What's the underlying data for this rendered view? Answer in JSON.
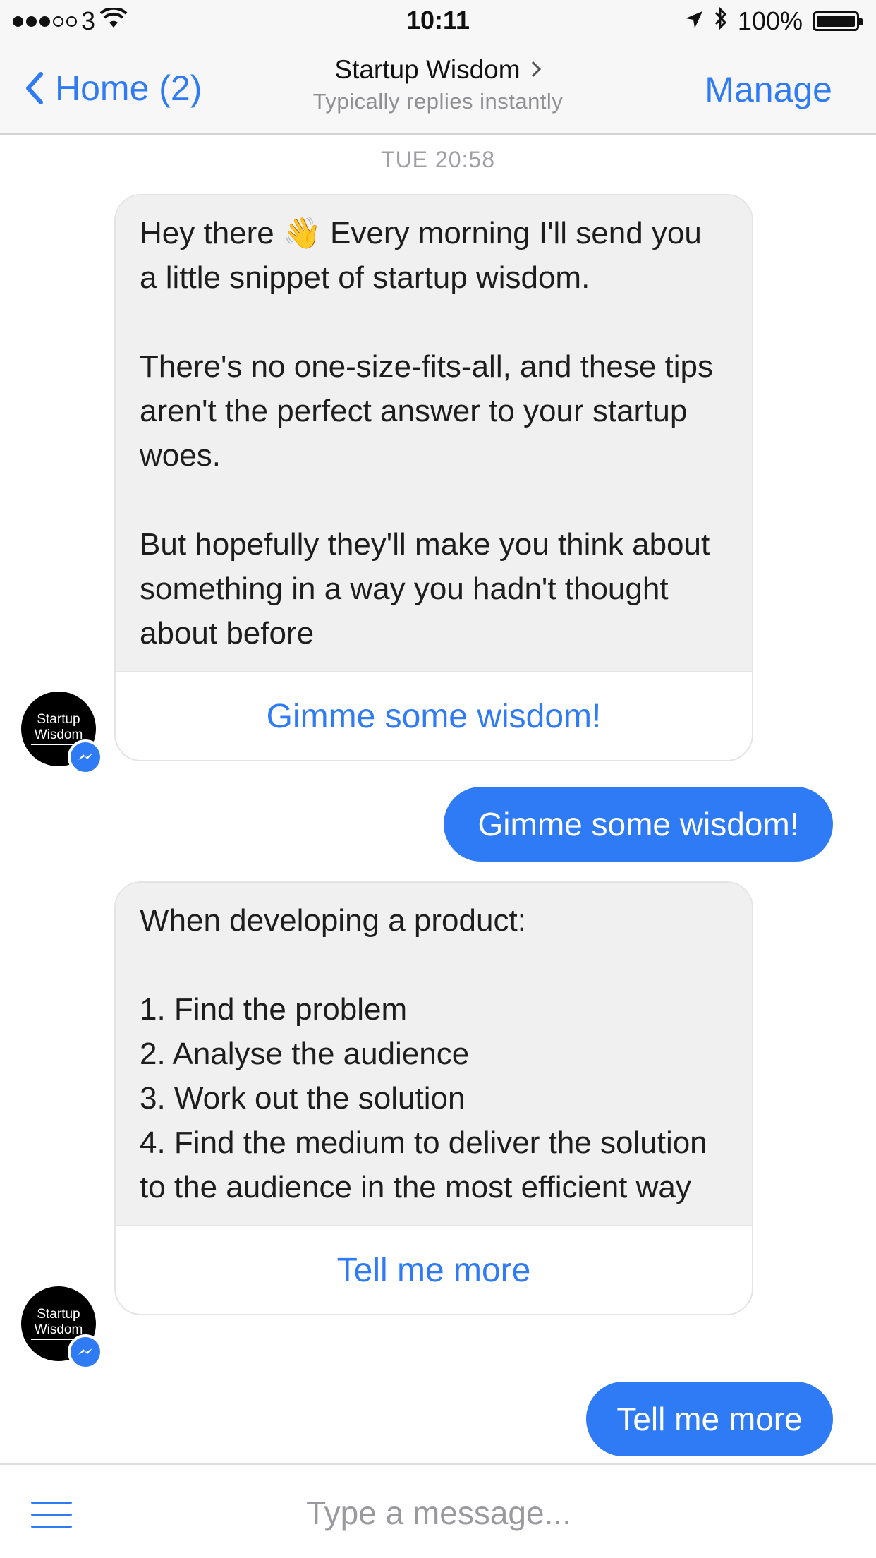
{
  "status_bar": {
    "carrier": "3",
    "time": "10:11",
    "battery": "100%",
    "icons": [
      "signal-dots-icon",
      "wifi-icon",
      "location-arrow-icon",
      "bluetooth-icon",
      "battery-icon"
    ]
  },
  "nav": {
    "back_label": "Home (2)",
    "title": "Startup Wisdom",
    "subtitle": "Typically replies instantly",
    "manage_label": "Manage"
  },
  "conversation": {
    "timestamp": "TUE 20:58",
    "avatar_text": {
      "line1": "Startup",
      "line2": "Wisdom"
    },
    "messages": [
      {
        "sender": "bot",
        "text": "Hey there 👋 Every morning I'll send you a little snippet of startup wisdom.\n\nThere's no one-size-fits-all, and these tips aren't the perfect answer to your startup woes.\n\nBut hopefully they'll make you think about something in a way you hadn't thought about before",
        "button": "Gimme some wisdom!"
      },
      {
        "sender": "user",
        "text": "Gimme some wisdom!"
      },
      {
        "sender": "bot",
        "text": "When developing a product:\n\n1. Find the problem\n2. Analyse the audience\n3. Work out the solution\n4. Find the medium to deliver the solution to the audience in the most efficient way",
        "button": "Tell me more"
      },
      {
        "sender": "user",
        "text": "Tell me more"
      }
    ]
  },
  "composer": {
    "placeholder": "Type a message..."
  },
  "colors": {
    "accent": "#2f7bf5",
    "bot_bubble": "#f0f0f0",
    "bar_background": "#f7f7f7"
  }
}
